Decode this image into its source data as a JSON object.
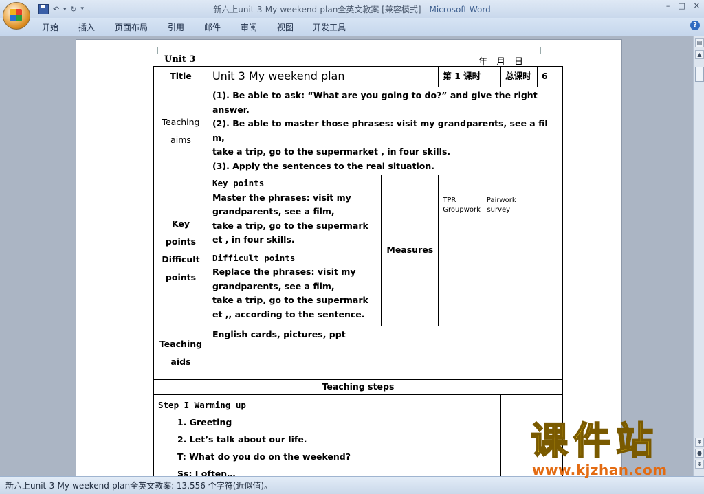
{
  "window": {
    "title_doc": "新六上unit-3-My-weekend-plan全英文教案 [兼容模式] -",
    "title_app": "Microsoft Word",
    "controls": [
      "–",
      "□",
      "✕"
    ]
  },
  "ribbon": {
    "tabs": [
      "开始",
      "插入",
      "页面布局",
      "引用",
      "邮件",
      "审阅",
      "视图",
      "开发工具"
    ],
    "help": "?"
  },
  "document": {
    "unit_label": "Unit 3",
    "date_label": "______年__月__日",
    "title_label": "Title",
    "title_value": "Unit 3 My weekend plan",
    "period_label": "第 1 课时",
    "total_label": "总课时",
    "total_value": "6",
    "aims_label_1": "Teaching",
    "aims_label_2": "aims",
    "aims": [
      "(1). Be able to ask: “What are you going to do?” and give the right",
      "answer.",
      "(2). Be able to master those phrases: visit my grandparents, see a fil",
      "m,",
      " take a trip, go to the supermarket , in four skills.",
      "(3). Apply the sentences to the real situation."
    ],
    "kp_label": [
      "Key",
      "points",
      "Difficult",
      "points"
    ],
    "key_points_title": "Key points",
    "key_points": [
      " Master the phrases: visit my",
      "grandparents, see a film,",
      " take a trip, go to the supermark",
      "et , in four skills."
    ],
    "difficult_points_title": "Difficult points",
    "difficult_points": [
      "Replace the phrases: visit my",
      "grandparents, see a film,",
      " take a trip, go to the supermark",
      "et ,, according to the sentence."
    ],
    "measures_label": "Measures",
    "measures_1": "TPR              Pairwork",
    "measures_2": "Groupwork   survey",
    "aids_label_1": "Teaching",
    "aids_label_2": "aids",
    "aids_value": "English cards, pictures, ppt",
    "steps_header": "Teaching steps",
    "steps": [
      "Step  I   Warming  up",
      "1. Greeting",
      "2. Let’s talk about our life.",
      "T: What do you do on the weekend?",
      "Ss: I often…"
    ]
  },
  "status": {
    "text": "新六上unit-3-My-weekend-plan全英文教案: 13,556 个字符(近似值)。"
  },
  "watermark": {
    "main": "课件站",
    "url": "www.kjzhan.com"
  }
}
